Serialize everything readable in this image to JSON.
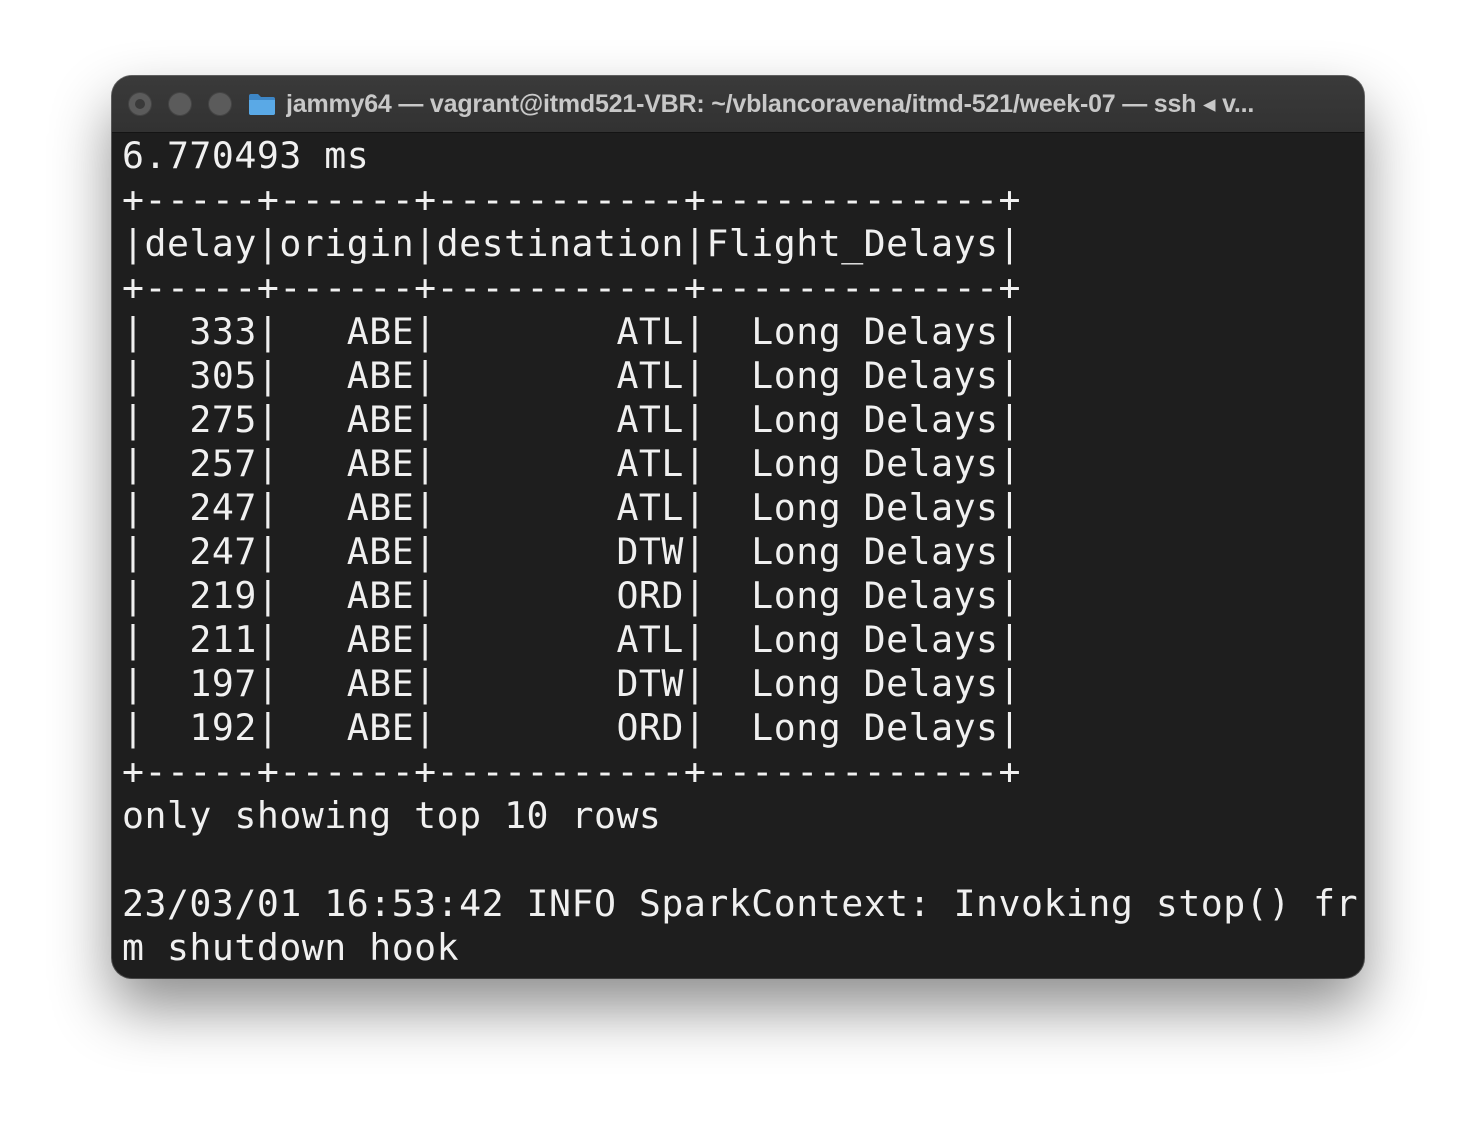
{
  "window": {
    "title": "jammy64 — vagrant@itmd521-VBR: ~/vblancoravena/itmd-521/week-07 — ssh ◂ v..."
  },
  "terminal": {
    "lines": [
      "6.770493 ms",
      "+-----+------+-----------+-------------+",
      "|delay|origin|destination|Flight_Delays|",
      "+-----+------+-----------+-------------+",
      "|  333|   ABE|        ATL|  Long Delays|",
      "|  305|   ABE|        ATL|  Long Delays|",
      "|  275|   ABE|        ATL|  Long Delays|",
      "|  257|   ABE|        ATL|  Long Delays|",
      "|  247|   ABE|        ATL|  Long Delays|",
      "|  247|   ABE|        DTW|  Long Delays|",
      "|  219|   ABE|        ORD|  Long Delays|",
      "|  211|   ABE|        ATL|  Long Delays|",
      "|  197|   ABE|        DTW|  Long Delays|",
      "|  192|   ABE|        ORD|  Long Delays|",
      "+-----+------+-----------+-------------+",
      "only showing top 10 rows",
      "",
      "23/03/01 16:53:42 INFO SparkContext: Invoking stop() fro",
      "m shutdown hook"
    ]
  },
  "colors": {
    "terminal_bg": "#1e1e1e",
    "terminal_fg": "#f0f0f0",
    "titlebar_bg": "#363636",
    "title_text": "#c8c8c8",
    "folder_icon": "#5aa9e6"
  }
}
